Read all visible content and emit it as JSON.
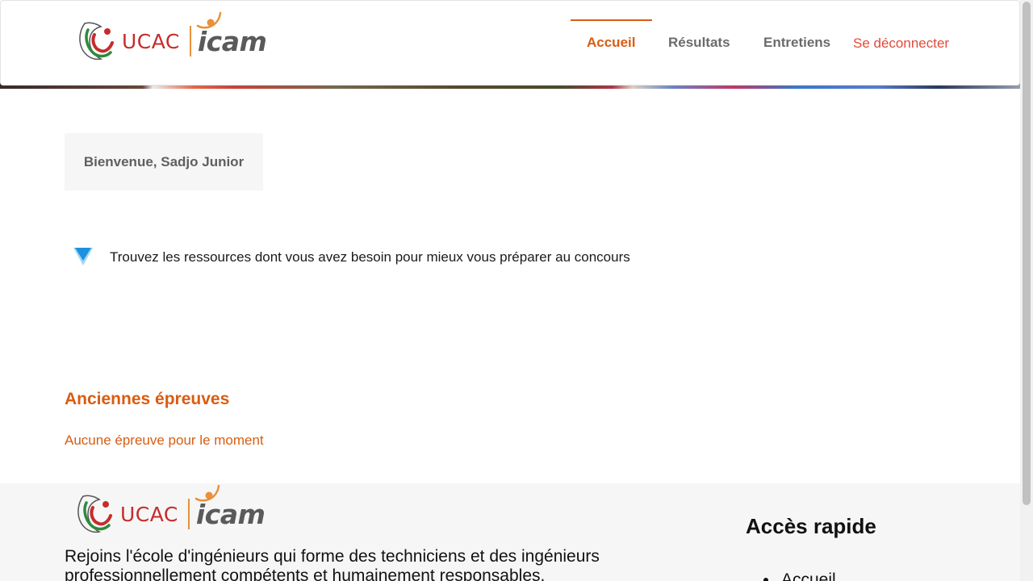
{
  "header": {
    "logo": {
      "ucac": "UCAC",
      "icam": "icam"
    },
    "nav": [
      {
        "label": "Accueil",
        "active": true
      },
      {
        "label": "Résultats",
        "active": false
      },
      {
        "label": "Entretiens",
        "active": false
      }
    ],
    "logout_label": "Se déconnecter"
  },
  "main": {
    "welcome": "Bienvenue, Sadjo Junior",
    "resources_text": "Trouvez les ressources dont vous avez besoin pour mieux vous préparer au concours",
    "past_exams_title": "Anciennes épreuves",
    "past_exams_empty": "Aucune épreuve pour le moment"
  },
  "footer": {
    "logo": {
      "ucac": "UCAC",
      "icam": "icam"
    },
    "description": "Rejoins l'école d'ingénieurs qui forme des techniciens et des ingénieurs professionnellement compétents et humainement responsables.",
    "quick_access_title": "Accès rapide",
    "quick_links": [
      "Accueil"
    ]
  },
  "colors": {
    "accent_orange": "#d85d12",
    "logout_red": "#e24a3b",
    "ucac_red": "#c62c2c"
  }
}
